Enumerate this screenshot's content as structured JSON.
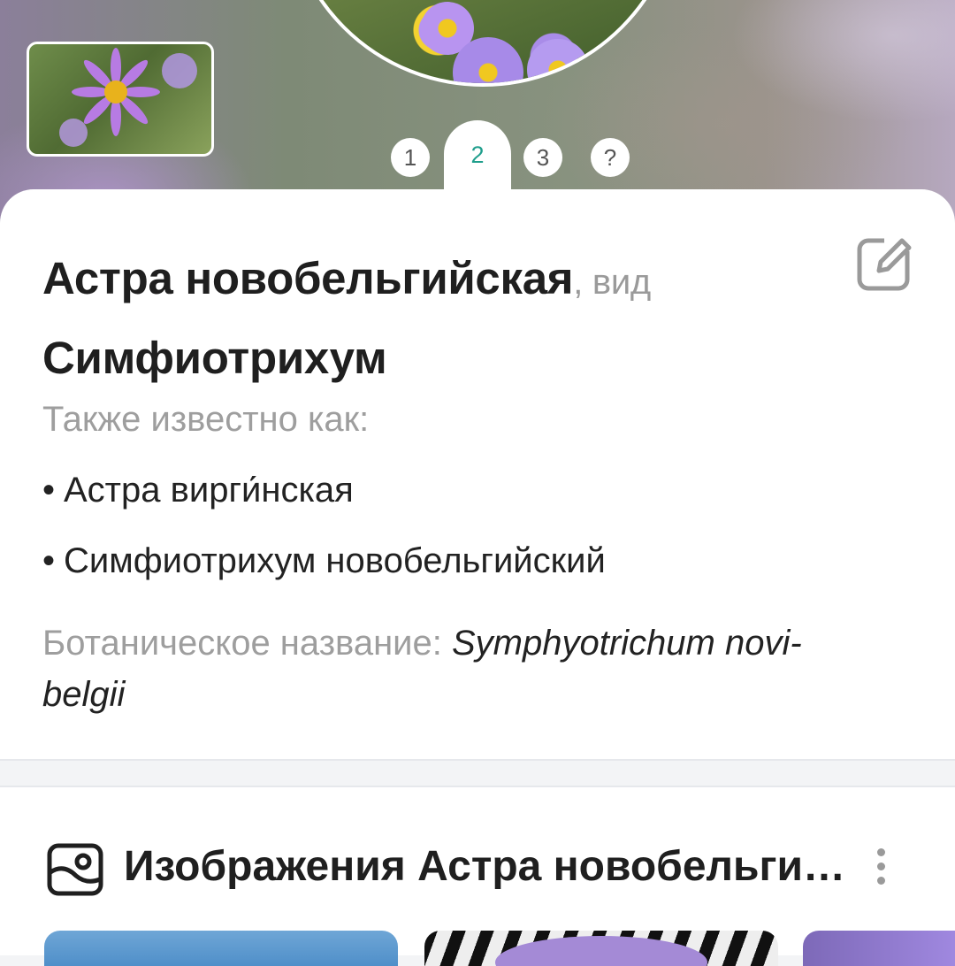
{
  "pager": {
    "items": [
      "1",
      "2",
      "3",
      "?"
    ],
    "active": "2"
  },
  "plant": {
    "common_name": "Астра новобельгийская",
    "rank_suffix": ", вид",
    "genus": "Симфиотрихум",
    "also_known_label": "Также известно как:",
    "also_known": [
      "Астра вирги́нская",
      "Симфиотрихум новобельгийский"
    ],
    "botanical_label": "Ботаническое название: ",
    "botanical_name": "Symphyotrichum novi-belgii"
  },
  "images_section": {
    "title": "Изображения Астра новобельгийская"
  },
  "icons": {
    "edit": "edit-icon",
    "gallery": "gallery-icon",
    "more": "more-vertical-icon"
  },
  "colors": {
    "accent": "#1f9e8c",
    "text_primary": "#1f1f1f",
    "text_secondary": "#9e9e9e"
  }
}
